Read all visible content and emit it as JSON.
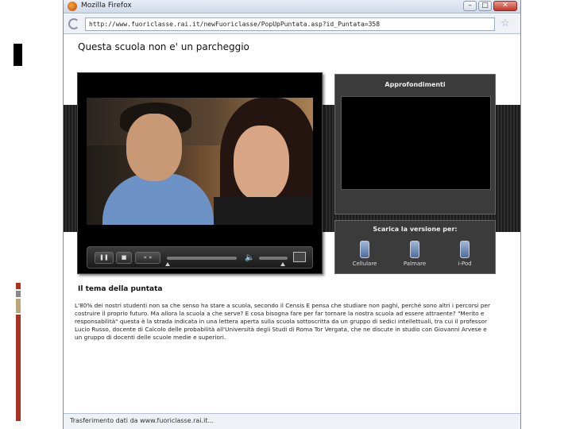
{
  "window": {
    "title": "Mozilla Firefox",
    "controls": {
      "minimize": "–",
      "maximize": "□",
      "close": "✕"
    }
  },
  "urlbar": {
    "url": "http://www.fuoriclasse.rai.it/newFuoriclasse/PopUpPuntata.asp?id_Puntata=358"
  },
  "page": {
    "title": "Questa scuola non e' un parcheggio",
    "player": {
      "play_label": "❚❚",
      "stop_label": "■",
      "skip_label": "«  »",
      "volume_icon": "🔈"
    },
    "approfondimenti": {
      "title": "Approfondimenti"
    },
    "download": {
      "title": "Scarica la versione per:",
      "devices": [
        {
          "label": "Cellulare",
          "icon": "cellphone-icon"
        },
        {
          "label": "Palmare",
          "icon": "pda-icon"
        },
        {
          "label": "i-Pod",
          "icon": "ipod-icon"
        }
      ]
    },
    "section_title": "Il tema della puntata",
    "body": "L'80% dei nostri studenti non sa che senso ha stare a scuola, secondo il Censis E pensa che studiare non paghi, perché sono altri i percorsi per costruire il proprio futuro. Ma allora la scuola a che serve? E cosa bisogna fare per far tornare la nostra scuola ad essere attraente? \"Merito e responsabilità\" questa è la strada indicata in una lettera aperta sulla scuola sottoscritta da un gruppo di sedici intellettuali, tra cui il professor Lucio Russo, docente di Calcolo delle probabilità all'Università degli Studi di Roma Tor Vergata, che ne discute in studio con Giovanni Arvese e un gruppo di docenti delle scuole medie e superiori."
  },
  "statusbar": {
    "text": "Trasferimento dati da www.fuoriclasse.rai.it..."
  }
}
